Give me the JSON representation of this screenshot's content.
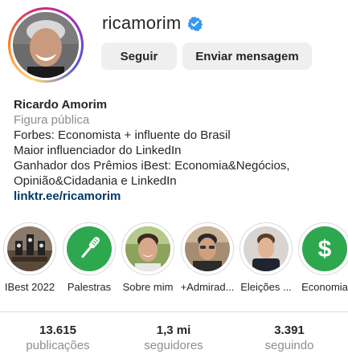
{
  "profile": {
    "username": "ricamorim",
    "verified": true,
    "follow_label": "Seguir",
    "message_label": "Enviar mensagem"
  },
  "bio": {
    "name": "Ricardo Amorim",
    "category": "Figura pública",
    "lines": [
      "Forbes: Economista + influente do Brasil",
      "Maior influenciador do LinkedIn",
      "Ganhador dos Prêmios iBest: Economia&Negócios,",
      "Opinião&Cidadania e LinkedIn"
    ],
    "link": "linktr.ee/ricamorim"
  },
  "highlights": [
    {
      "label": "IBest 2022",
      "icon": "trophy-photo"
    },
    {
      "label": "Palestras",
      "icon": "microphone-icon"
    },
    {
      "label": "Sobre mim",
      "icon": "portrait-photo"
    },
    {
      "label": "+Admirad...",
      "icon": "portrait-photo"
    },
    {
      "label": "Eleições ...",
      "icon": "portrait-photo"
    },
    {
      "label": "Economia",
      "icon": "dollar-icon"
    }
  ],
  "stats": {
    "posts_count": "13.615",
    "posts_label": "publicações",
    "followers_count": "1,3 mi",
    "followers_label": "seguidores",
    "following_count": "3.391",
    "following_label": "seguindo"
  },
  "colors": {
    "verified_blue": "#3897f0",
    "link_blue": "#00376b",
    "highlight_green": "#2ea84f",
    "button_gray": "#efefef"
  }
}
